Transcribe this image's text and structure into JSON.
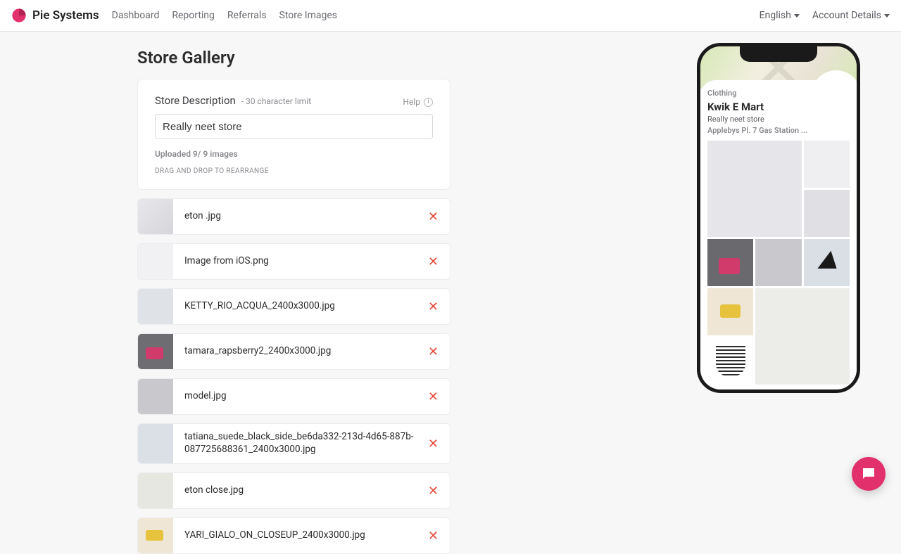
{
  "brand": {
    "name": "Pie Systems"
  },
  "nav": {
    "items": [
      "Dashboard",
      "Reporting",
      "Referrals",
      "Store Images"
    ],
    "language": "English",
    "account": "Account Details"
  },
  "page": {
    "title": "Store Gallery"
  },
  "form": {
    "desc_label": "Store Description",
    "desc_limit": "- 30 character limit",
    "help": "Help",
    "desc_value": "Really neet store",
    "uploaded": "Uploaded 9/ 9 images",
    "drag_note": "DRAG AND DROP TO REARRANGE"
  },
  "files": [
    {
      "name": "eton .jpg"
    },
    {
      "name": "Image from iOS.png"
    },
    {
      "name": "KETTY_RIO_ACQUA_2400x3000.jpg"
    },
    {
      "name": "tamara_rapsberry2_2400x3000.jpg"
    },
    {
      "name": "model.jpg"
    },
    {
      "name": "tatiana_suede_black_side_be6da332-213d-4d65-887b-087725688361_2400x3000.jpg"
    },
    {
      "name": "eton close.jpg"
    },
    {
      "name": "YARI_GIALO_ON_CLOSEUP_2400x3000.jpg"
    }
  ],
  "preview": {
    "category": "Clothing",
    "store_name": "Kwik E Mart",
    "store_desc": "Really neet store",
    "address": "Applebys Pl. 7 Gas Station ..."
  }
}
